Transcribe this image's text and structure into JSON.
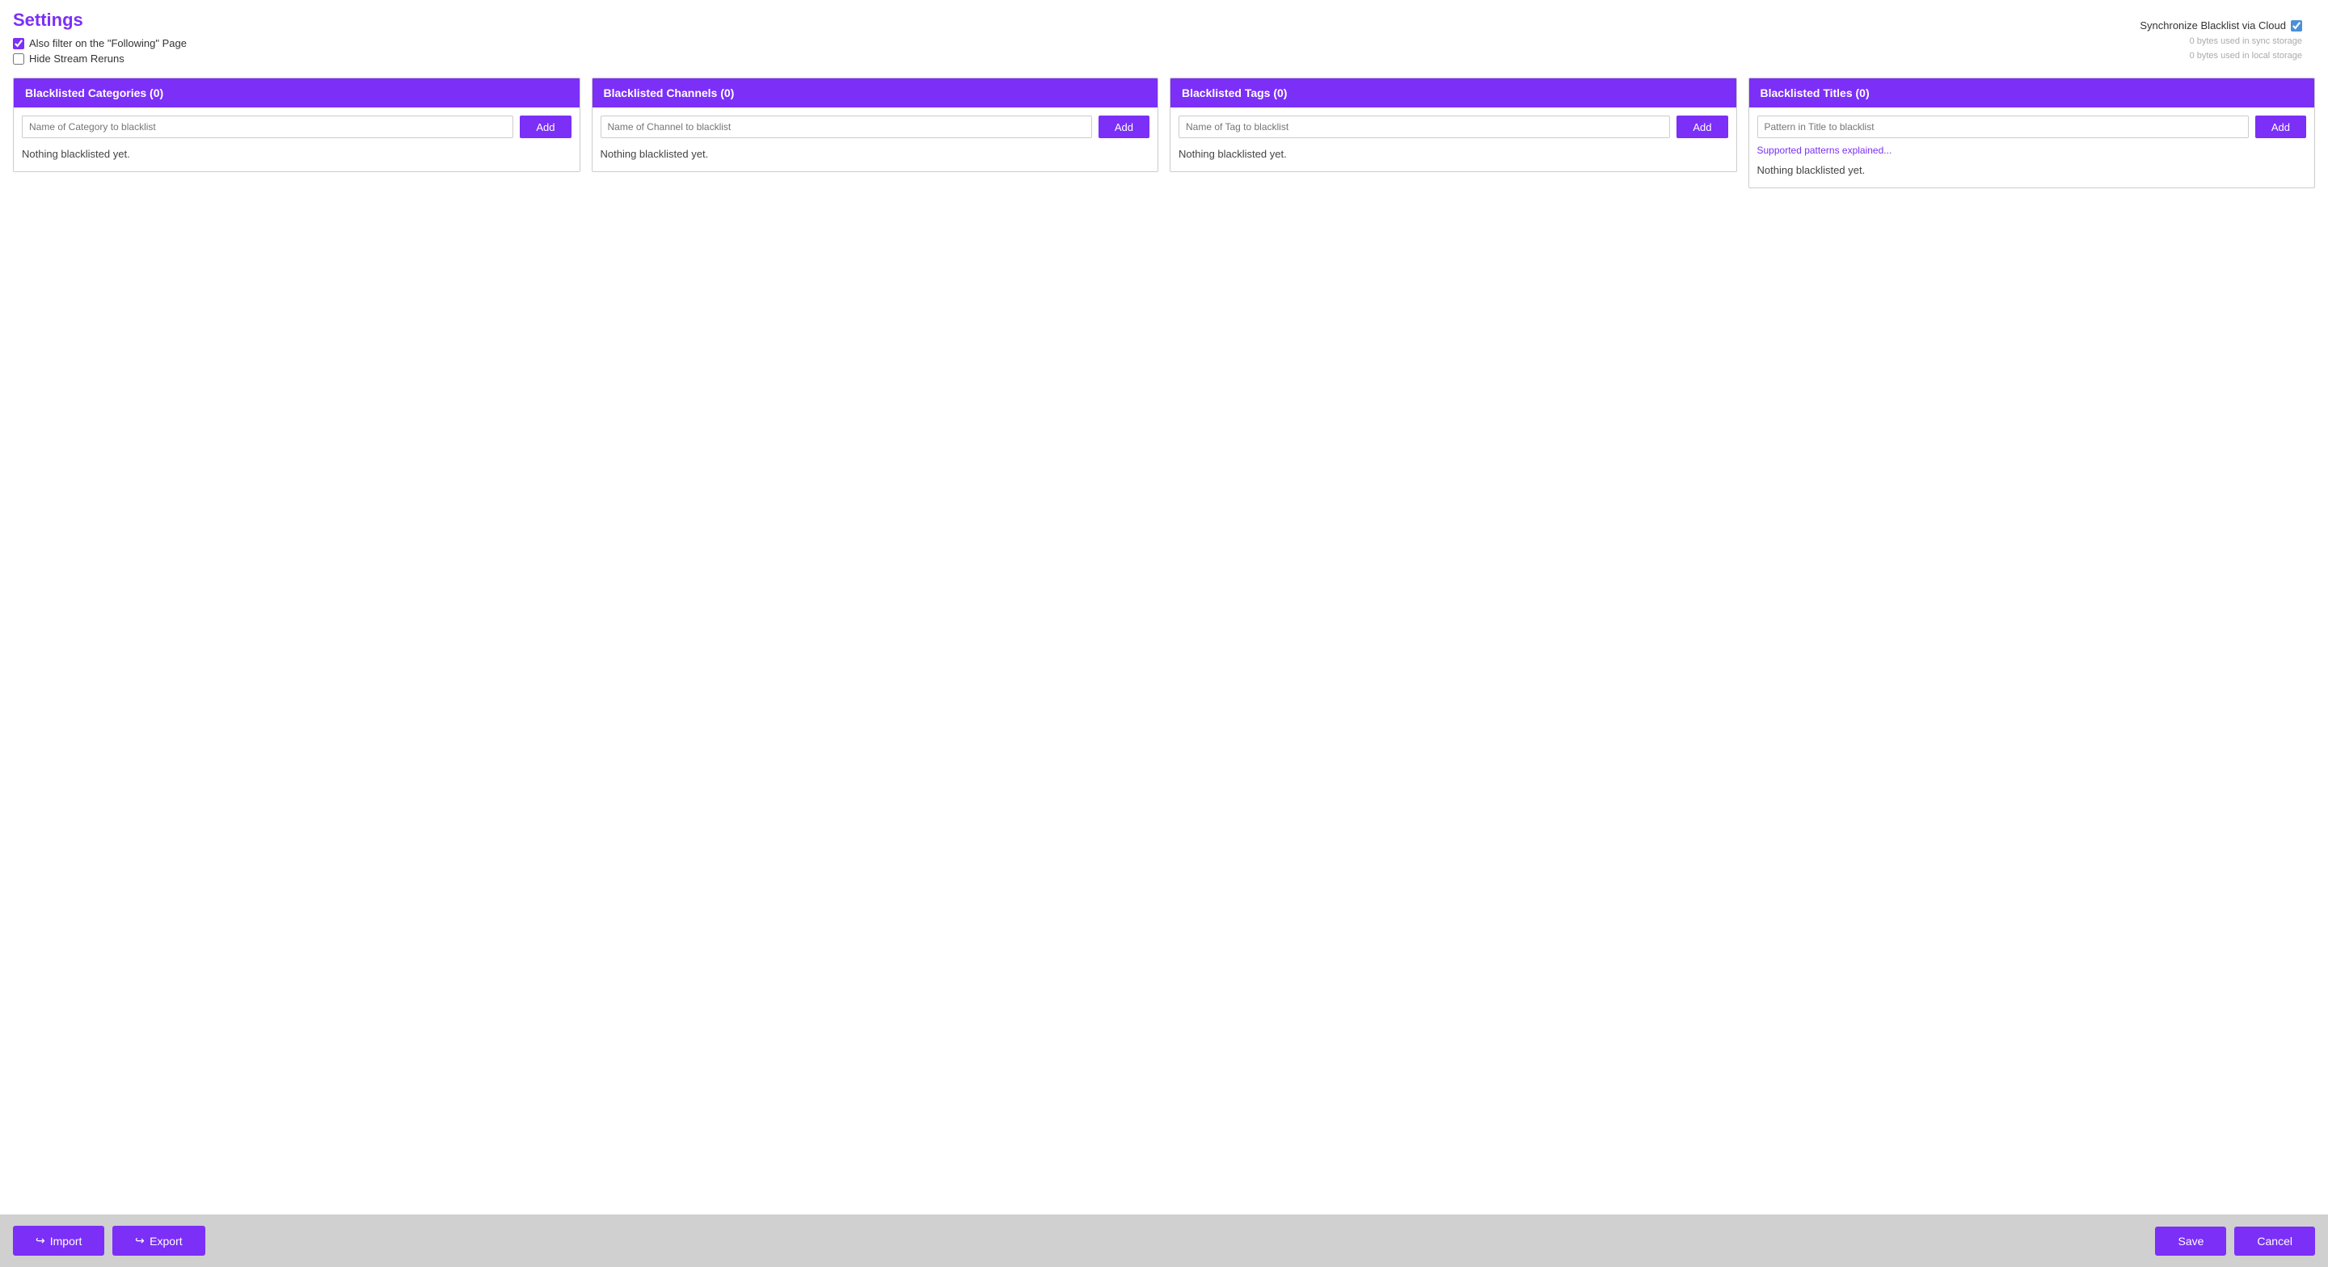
{
  "page": {
    "title": "Settings"
  },
  "options": {
    "also_filter_following": {
      "label": "Also filter on the \"Following\" Page",
      "checked": true
    },
    "hide_stream_reruns": {
      "label": "Hide Stream Reruns",
      "checked": false
    },
    "sync_cloud": {
      "label": "Synchronize Blacklist via Cloud",
      "checked": true
    }
  },
  "storage": {
    "sync_line": "0 bytes used in  sync storage",
    "local_line": "0 bytes used in local storage"
  },
  "panels": {
    "categories": {
      "header": "Blacklisted Categories (0)",
      "input_placeholder": "Name of Category to blacklist",
      "add_label": "Add",
      "empty_label": "Nothing blacklisted yet."
    },
    "channels": {
      "header": "Blacklisted Channels (0)",
      "input_placeholder": "Name of Channel to blacklist",
      "add_label": "Add",
      "empty_label": "Nothing blacklisted yet."
    },
    "tags": {
      "header": "Blacklisted Tags (0)",
      "input_placeholder": "Name of Tag to blacklist",
      "add_label": "Add",
      "empty_label": "Nothing blacklisted yet."
    },
    "titles": {
      "header": "Blacklisted Titles (0)",
      "input_placeholder": "Pattern in Title to blacklist",
      "add_label": "Add",
      "empty_label": "Nothing blacklisted yet.",
      "patterns_link": "Supported patterns explained..."
    }
  },
  "footer": {
    "import_label": "Import",
    "export_label": "Export",
    "save_label": "Save",
    "cancel_label": "Cancel"
  }
}
